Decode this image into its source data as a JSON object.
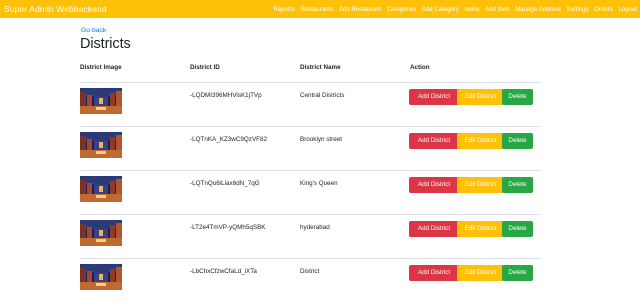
{
  "navbar": {
    "brand": "Super Admin Webbackend",
    "links": [
      "Reports",
      "Restaurants",
      "Add Restaurant",
      "Categories",
      "Add Category",
      "Items",
      "Add Item",
      "Manage Address",
      "Settings",
      "Orders",
      "Logout"
    ]
  },
  "page": {
    "go_back": "Go back",
    "title": "Districts"
  },
  "table": {
    "headers": [
      "District Image",
      "District ID",
      "District Name",
      "Action"
    ],
    "rows": [
      {
        "id": "-LQDMI396MHVisK1jTVp",
        "name": "Central Districts"
      },
      {
        "id": "-LQTnKA_KZ3wC9QzVF82",
        "name": "Brooklyn street"
      },
      {
        "id": "-LQTnQu6iLiax6dN_7qG",
        "name": "King's Queen"
      },
      {
        "id": "-LT2e4TmVP-yQMh5qSBK",
        "name": "hyderabad"
      },
      {
        "id": "-LbChxCfzwCfaLd_iXTa",
        "name": "District"
      }
    ],
    "actions": {
      "add": "Add District",
      "edit": "Edit District",
      "delete": "Delete"
    }
  },
  "colors": {
    "navbar": "#ffc107",
    "link": "#007bff",
    "danger": "#dc3545",
    "warning": "#ffc107",
    "success": "#28a745"
  }
}
